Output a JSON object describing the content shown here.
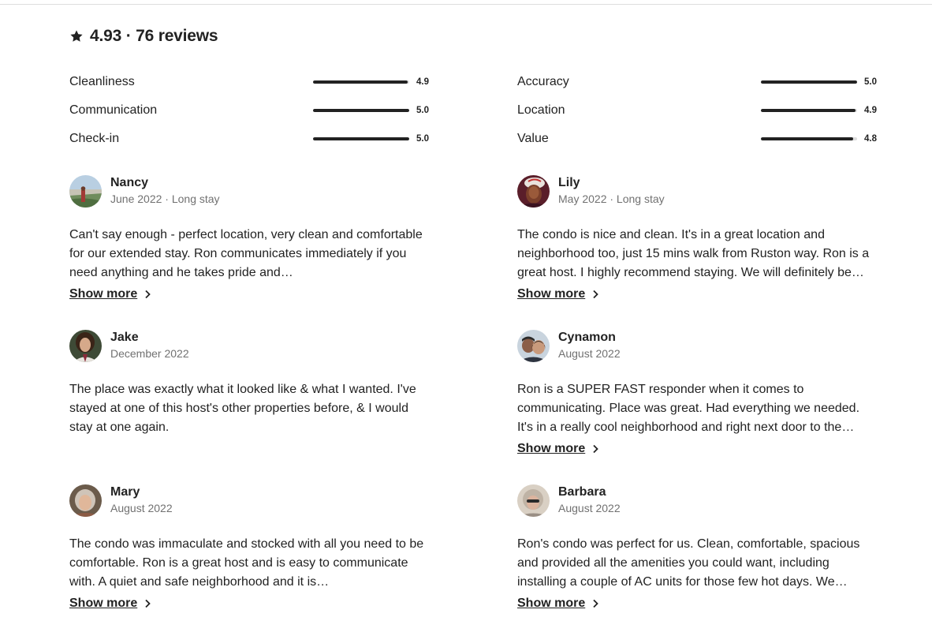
{
  "summary": {
    "icon": "star-icon",
    "title": "4.93 · 76 reviews"
  },
  "ratings": [
    {
      "label": "Cleanliness",
      "value": "4.9",
      "fraction": 0.98
    },
    {
      "label": "Accuracy",
      "value": "5.0",
      "fraction": 1.0
    },
    {
      "label": "Communication",
      "value": "5.0",
      "fraction": 1.0
    },
    {
      "label": "Location",
      "value": "4.9",
      "fraction": 0.98
    },
    {
      "label": "Check-in",
      "value": "5.0",
      "fraction": 1.0
    },
    {
      "label": "Value",
      "value": "4.8",
      "fraction": 0.96
    }
  ],
  "reviews": [
    {
      "name": "Nancy",
      "date": "June 2022 · Long stay",
      "text": "Can't say enough - perfect location, very clean and comfortable for our extended stay. Ron communicates immediately if you need anything and he takes pride and…",
      "show_more": "Show more"
    },
    {
      "name": "Lily",
      "date": "May 2022 · Long stay",
      "text": "The condo is nice and clean. It's in a great location and neighborhood too, just 15 mins walk from Ruston way. Ron is a great host. I highly recommend staying. We will definitely be…",
      "show_more": "Show more"
    },
    {
      "name": "Jake",
      "date": "December 2022",
      "text": "The place was exactly what it looked like & what I wanted. I've stayed at one of this host's other properties before, & I would stay at one again.",
      "show_more": ""
    },
    {
      "name": "Cynamon",
      "date": "August 2022",
      "text": "Ron is a SUPER FAST responder when it comes to communicating. Place was great. Had everything we needed. It's in a really cool neighborhood and right next door to the…",
      "show_more": "Show more"
    },
    {
      "name": "Mary",
      "date": "August 2022",
      "text": "The condo was immaculate and stocked with all you need to be comfortable. Ron is a great host and is easy to communicate with. A quiet and safe neighborhood and it is…",
      "show_more": "Show more"
    },
    {
      "name": "Barbara",
      "date": "August 2022",
      "text": "Ron's condo was perfect for us. Clean, comfortable, spacious and provided all the amenities you could want, including installing a couple of AC units for those few hot days. We…",
      "show_more": "Show more"
    }
  ],
  "colors": {
    "text": "#222222",
    "muted": "#717171",
    "bar_track": "#dddddd",
    "bar_fill": "#222222"
  }
}
